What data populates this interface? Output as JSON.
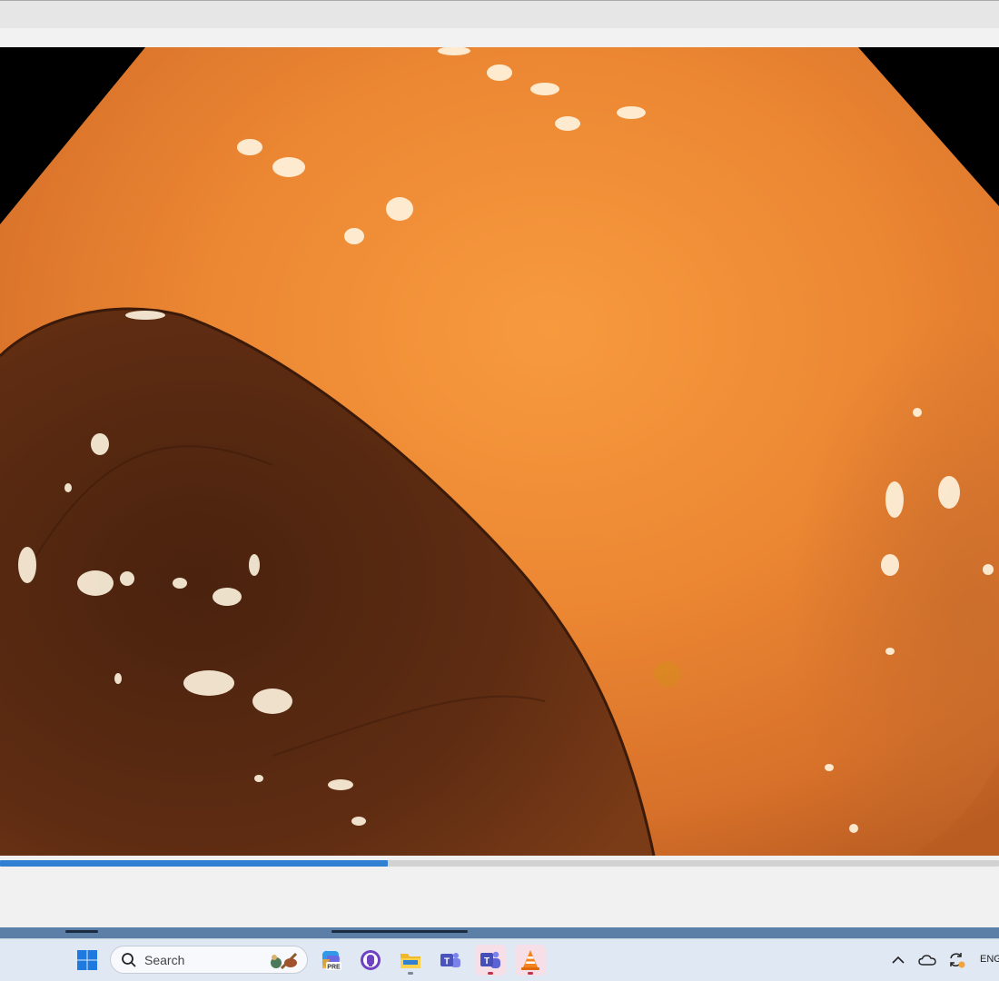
{
  "player": {
    "progress": 0.388,
    "accent_color": "#2f7fd3"
  },
  "taskbar": {
    "search": {
      "placeholder": "Search"
    },
    "pinned": [
      {
        "name": "windows-start-icon"
      },
      {
        "name": "search-icon"
      },
      {
        "name": "copilot-pre-icon"
      },
      {
        "name": "github-desktop-icon"
      },
      {
        "name": "file-explorer-icon"
      },
      {
        "name": "teams-classic-icon"
      },
      {
        "name": "teams-icon"
      },
      {
        "name": "vlc-icon"
      }
    ],
    "tray": {
      "items": [
        "chevron-up-icon",
        "onedrive-icon",
        "sync-icon"
      ],
      "language": "ENG"
    }
  }
}
